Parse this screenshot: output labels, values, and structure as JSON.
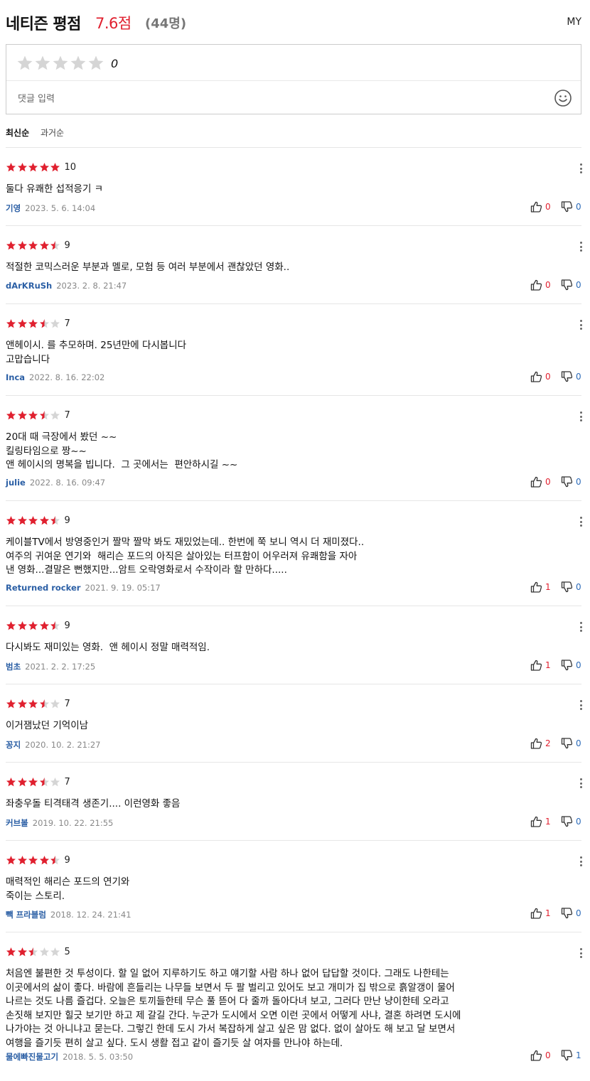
{
  "header": {
    "title": "네티즌 평점",
    "score": "7.6점",
    "count": "(44명)",
    "my": "MY"
  },
  "comment_input": {
    "rating_value": "0",
    "placeholder": "댓글 입력"
  },
  "sort": {
    "active": "최신순",
    "inactive": "과거순"
  },
  "colors": {
    "accent_red": "#e0202f",
    "username_blue": "#2b5fa5",
    "star_empty": "#d5d5d5"
  },
  "reviews": [
    {
      "rating": 10,
      "rating_label": "10",
      "text": "둘다 유쾌한 섭적응기 ㅋ",
      "user": "기영",
      "date": "2023. 5. 6. 14:04",
      "likes": "0",
      "dislikes": "0"
    },
    {
      "rating": 9,
      "rating_label": "9",
      "text": "적절한 코믹스러운 부분과 멜로, 모험 등 여러 부분에서 괜찮았던 영화..",
      "user": "dArKRuSh",
      "date": "2023. 2. 8. 21:47",
      "likes": "0",
      "dislikes": "0"
    },
    {
      "rating": 7,
      "rating_label": "7",
      "text": "앤헤이시. 를 추모하며. 25년만에 다시봅니다\n고맙습니다",
      "user": "Inca",
      "date": "2022. 8. 16. 22:02",
      "likes": "0",
      "dislikes": "0"
    },
    {
      "rating": 7,
      "rating_label": "7",
      "text": "20대 때 극장에서 봤던 ~~\n킬링타임으로 짱~~\n앤 헤이시의 명복을 빕니다.  그 곳에서는  편안하시길 ~~",
      "user": "julie",
      "date": "2022. 8. 16. 09:47",
      "likes": "0",
      "dislikes": "0"
    },
    {
      "rating": 9,
      "rating_label": "9",
      "text": "케이블TV에서 방영중인거 짤막 짤막 봐도 재밌었는데.. 한번에 쭉 보니 역시 더 재미졌다..\n여주의 귀여운 연기와  해리슨 포드의 아직은 살아있는 터프함이 어우러져 유쾌함을 자아\n낸 영화...결말은 뻔했지만...암트 오락영화로서 수작이라 할 만하다.....",
      "user": "Returned rocker",
      "date": "2021. 9. 19. 05:17",
      "likes": "1",
      "dislikes": "0"
    },
    {
      "rating": 9,
      "rating_label": "9",
      "text": "다시봐도 재미있는 영화.  앤 헤이시 정말 매력적임.",
      "user": "범초",
      "date": "2021. 2. 2. 17:25",
      "likes": "1",
      "dislikes": "0"
    },
    {
      "rating": 7,
      "rating_label": "7",
      "text": "이거잼났던 기억이남",
      "user": "꽁지",
      "date": "2020. 10. 2. 21:27",
      "likes": "2",
      "dislikes": "0"
    },
    {
      "rating": 7,
      "rating_label": "7",
      "text": "좌충우돌 티격태격 생존기.... 이런영화 좋음",
      "user": "커브볼",
      "date": "2019. 10. 22. 21:55",
      "likes": "1",
      "dislikes": "0"
    },
    {
      "rating": 9,
      "rating_label": "9",
      "text": "매력적인 해리슨 포드의 연기와\n죽이는 스토리.",
      "user": "빽 프라블럼",
      "date": "2018. 12. 24. 21:41",
      "likes": "1",
      "dislikes": "0"
    },
    {
      "rating": 5,
      "rating_label": "5",
      "text": "처음엔 불편한 것 투성이다. 할 일 없어 지루하기도 하고 얘기할 사람 하나 없어 답답할 것이다. 그래도 나한테는\n이곳에서의 삶이 좋다. 바람에 흔들리는 나무들 보면서 두 팔 벌리고 있어도 보고 개미가 집 밖으로 흙알갱이 물어\n나르는 것도 나름 즐겁다. 오늘은 토끼들한테 무슨 풀 뜯어 다 줄까 돌아다녀 보고, 그러다 만난 냥이한테 오라고\n손짓해 보지만 힐긋 보기만 하고 제 갈길 간다. 누군가 도시에서 오면 이런 곳에서 어떻게 사냐, 결혼 하려면 도시에\n나가야는 것 아니냐고 묻는다. 그렇긴 한데 도시 가서 복잡하게 살고 싶은 맘 없다. 없이 살아도 해 보고 달 보면서\n여행을 즐기듯 편히 살고 싶다. 도시 생활 접고 같이 즐기듯 살 여자를 만나야 하는데.",
      "user": "물에빠진물고기",
      "date": "2018. 5. 5. 03:50",
      "likes": "0",
      "dislikes": "1"
    }
  ]
}
